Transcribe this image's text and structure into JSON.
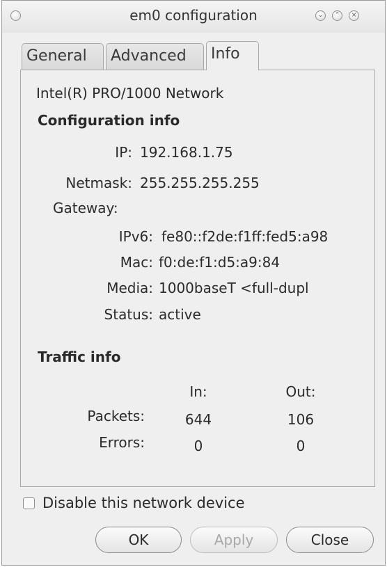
{
  "window": {
    "title": "em0 configuration"
  },
  "tabs": [
    {
      "label": "General",
      "active": false
    },
    {
      "label": "Advanced",
      "active": false
    },
    {
      "label": "Info",
      "active": true
    }
  ],
  "device_name": "Intel(R) PRO/1000 Network",
  "config": {
    "heading": "Configuration info",
    "ip_label": "IP:",
    "ip_value": "192.168.1.75",
    "netmask_label": "Netmask:",
    "netmask_value": "255.255.255.255",
    "gateway_label": "Gateway:",
    "gateway_value": "",
    "ipv6_label": "IPv6:",
    "ipv6_value": "fe80::f2de:f1ff:fed5:a98",
    "mac_label": "Mac:",
    "mac_value": "f0:de:f1:d5:a9:84",
    "media_label": "Media:",
    "media_value": "1000baseT <full-dupl",
    "status_label": "Status:",
    "status_value": "active"
  },
  "traffic": {
    "heading": "Traffic info",
    "in_header": "In:",
    "out_header": "Out:",
    "packets_label": "Packets:",
    "packets_in": "644",
    "packets_out": "106",
    "errors_label": "Errors:",
    "errors_in": "0",
    "errors_out": "0"
  },
  "disable_device": {
    "label": "Disable this network device",
    "checked": false
  },
  "buttons": {
    "ok": "OK",
    "apply": "Apply",
    "close": "Close"
  }
}
